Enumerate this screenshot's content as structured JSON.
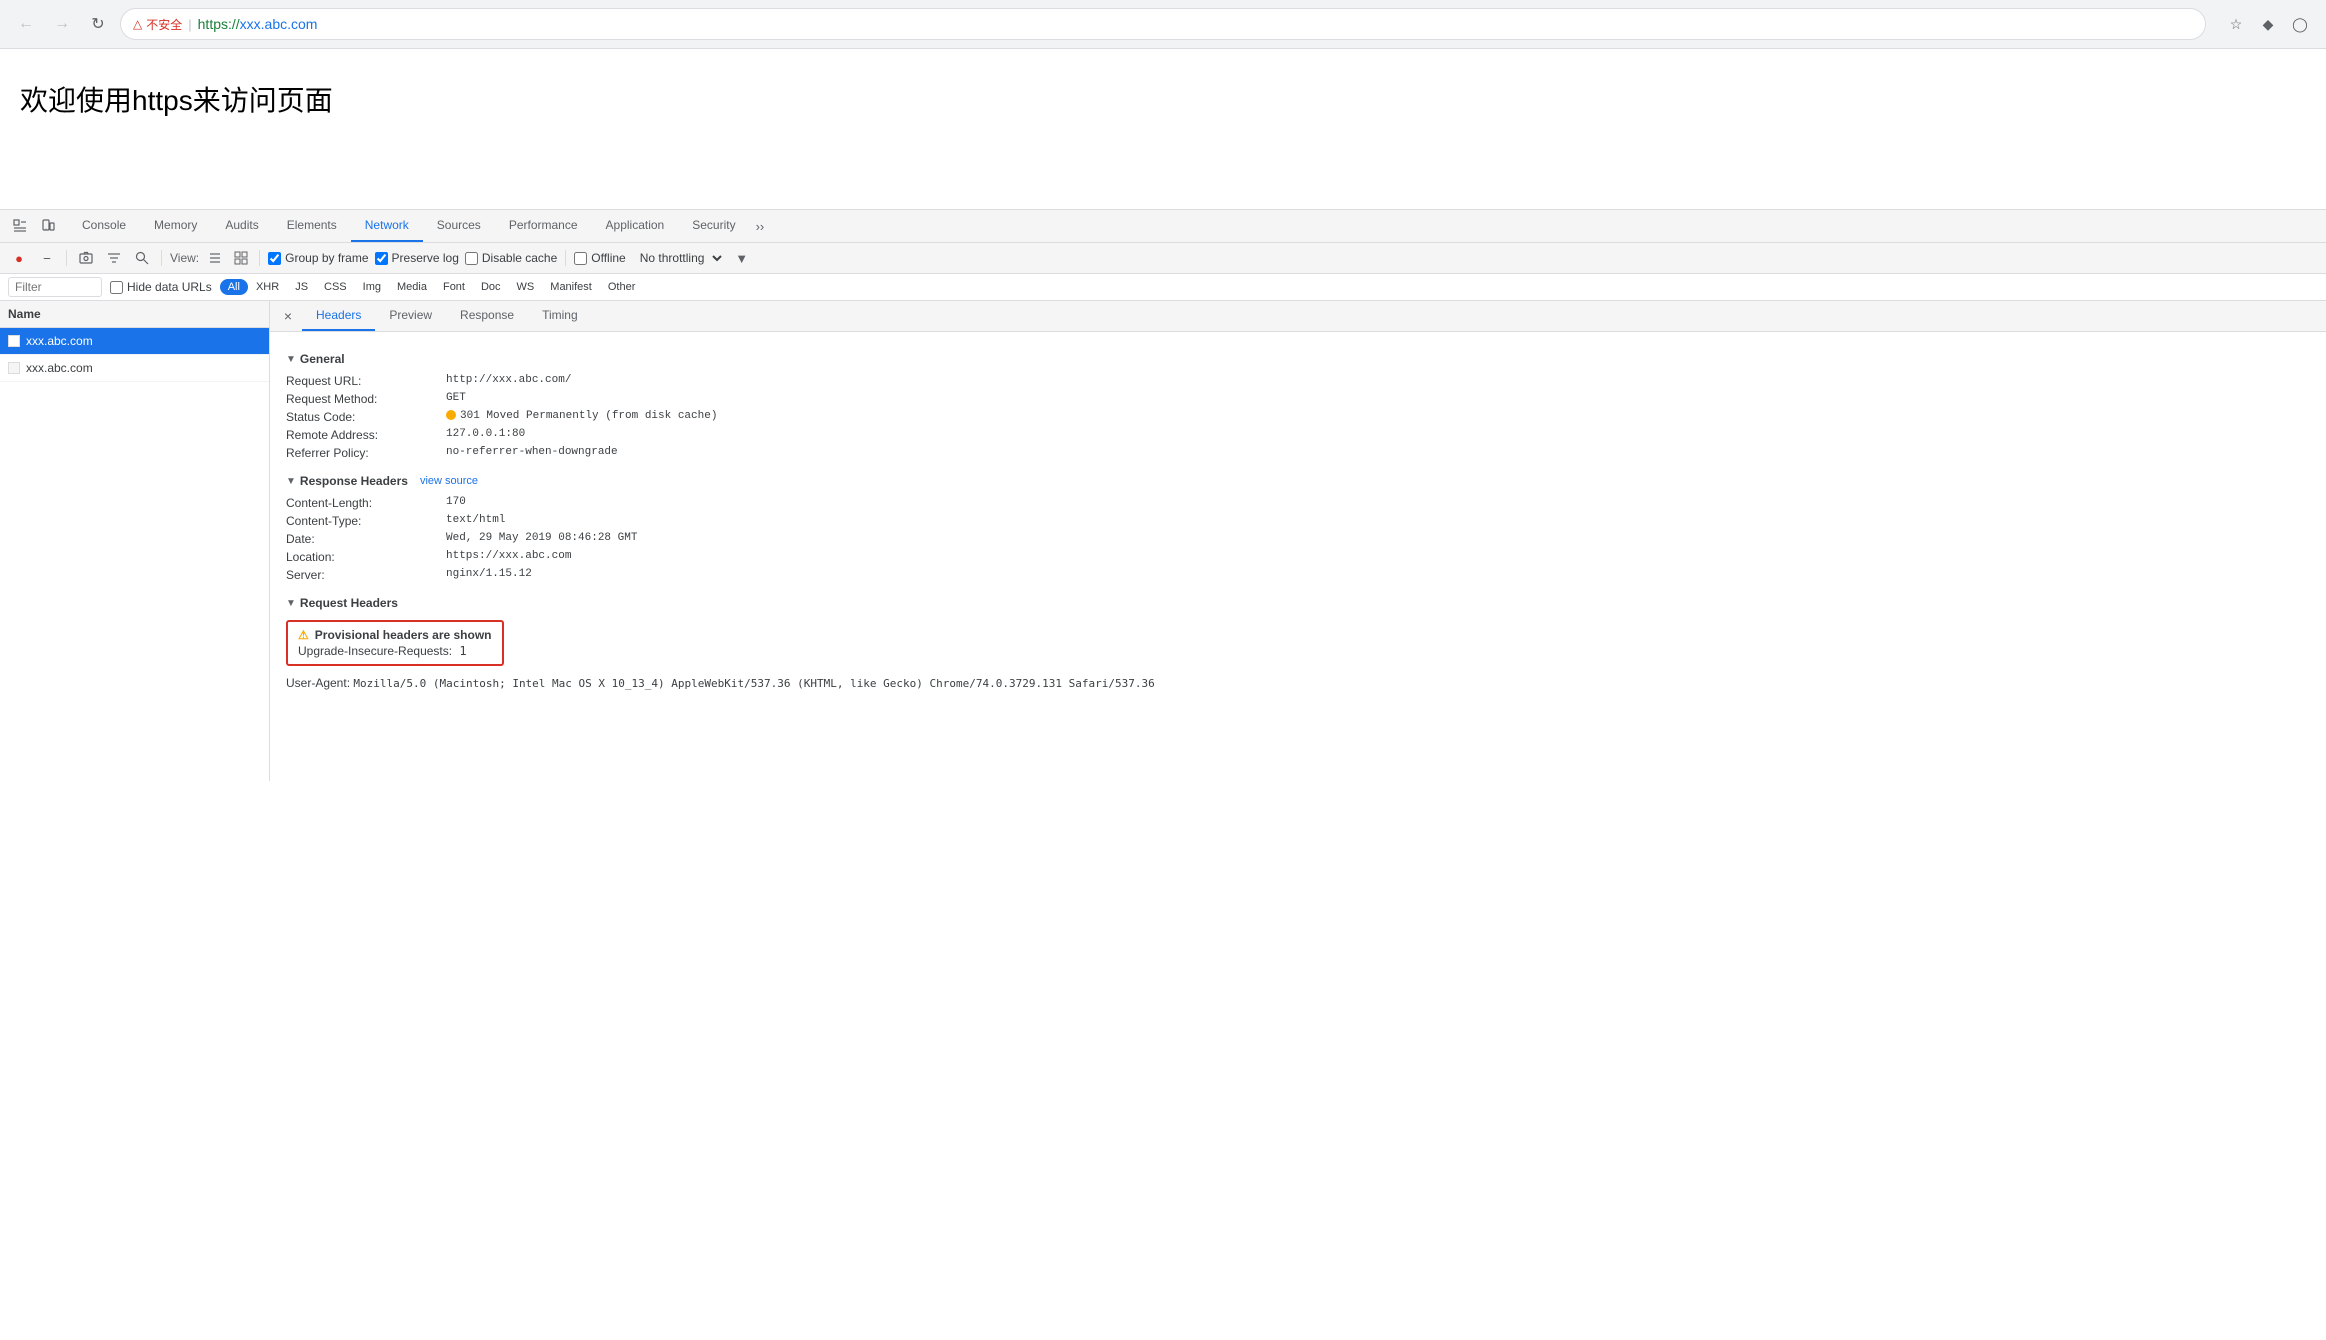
{
  "browser": {
    "back_disabled": true,
    "forward_disabled": true,
    "reload_label": "↺",
    "security_warning": "不安全",
    "separator": "|",
    "url_prefix": "https://",
    "url_domain": "xxx.abc.com",
    "star_icon": "☆",
    "extensions_icon": "◈",
    "profile_icon": "◉"
  },
  "page": {
    "title": "欢迎使用https来访问页面"
  },
  "devtools": {
    "tabs": [
      {
        "label": "Console",
        "active": false
      },
      {
        "label": "Memory",
        "active": false
      },
      {
        "label": "Audits",
        "active": false
      },
      {
        "label": "Elements",
        "active": false
      },
      {
        "label": "Network",
        "active": true
      },
      {
        "label": "Sources",
        "active": false
      },
      {
        "label": "Performance",
        "active": false
      },
      {
        "label": "Application",
        "active": false
      },
      {
        "label": "Security",
        "active": false
      }
    ],
    "toolbar": {
      "record_tooltip": "Record network log",
      "clear_tooltip": "Clear",
      "camera_tooltip": "Capture screenshots",
      "filter_tooltip": "Filter",
      "search_tooltip": "Search",
      "view_label": "View:",
      "group_by_frame_label": "Group by frame",
      "group_by_frame_checked": true,
      "preserve_log_label": "Preserve log",
      "preserve_log_checked": true,
      "disable_cache_label": "Disable cache",
      "disable_cache_checked": false,
      "offline_label": "Offline",
      "offline_checked": false,
      "throttle_label": "No throttling"
    },
    "filter_bar": {
      "placeholder": "Filter",
      "hide_data_urls_label": "Hide data URLs",
      "filter_types": [
        "All",
        "XHR",
        "JS",
        "CSS",
        "Img",
        "Media",
        "Font",
        "Doc",
        "WS",
        "Manifest",
        "Other"
      ],
      "active_filter": "All"
    },
    "request_list": {
      "column_header": "Name",
      "items": [
        {
          "name": "xxx.abc.com",
          "selected": true
        },
        {
          "name": "xxx.abc.com",
          "selected": false
        }
      ]
    },
    "details": {
      "tabs": [
        "Headers",
        "Preview",
        "Response",
        "Timing"
      ],
      "active_tab": "Headers",
      "general": {
        "section_title": "General",
        "request_url_label": "Request URL:",
        "request_url_value": "http://xxx.abc.com/",
        "request_method_label": "Request Method:",
        "request_method_value": "GET",
        "status_code_label": "Status Code:",
        "status_code_value": "301 Moved Permanently (from disk cache)",
        "remote_address_label": "Remote Address:",
        "remote_address_value": "127.0.0.1:80",
        "referrer_policy_label": "Referrer Policy:",
        "referrer_policy_value": "no-referrer-when-downgrade"
      },
      "response_headers": {
        "section_title": "Response Headers",
        "view_source_label": "view source",
        "items": [
          {
            "name": "Content-Length:",
            "value": "170"
          },
          {
            "name": "Content-Type:",
            "value": "text/html"
          },
          {
            "name": "Date:",
            "value": "Wed, 29 May 2019 08:46:28 GMT"
          },
          {
            "name": "Location:",
            "value": "https://xxx.abc.com"
          },
          {
            "name": "Server:",
            "value": "nginx/1.15.12"
          }
        ]
      },
      "request_headers": {
        "section_title": "Request Headers",
        "provisional_warning": "⚠ Provisional headers are shown",
        "upgrade_row_name": "Upgrade-Insecure-Requests:",
        "upgrade_row_value": "1",
        "user_agent_name": "User-Agent:",
        "user_agent_value": "Mozilla/5.0 (Macintosh; Intel Mac OS X 10_13_4) AppleWebKit/537.36 (KHTML, like Gecko) Chrome/74.0.3729.131 Safari/537.36"
      }
    }
  }
}
